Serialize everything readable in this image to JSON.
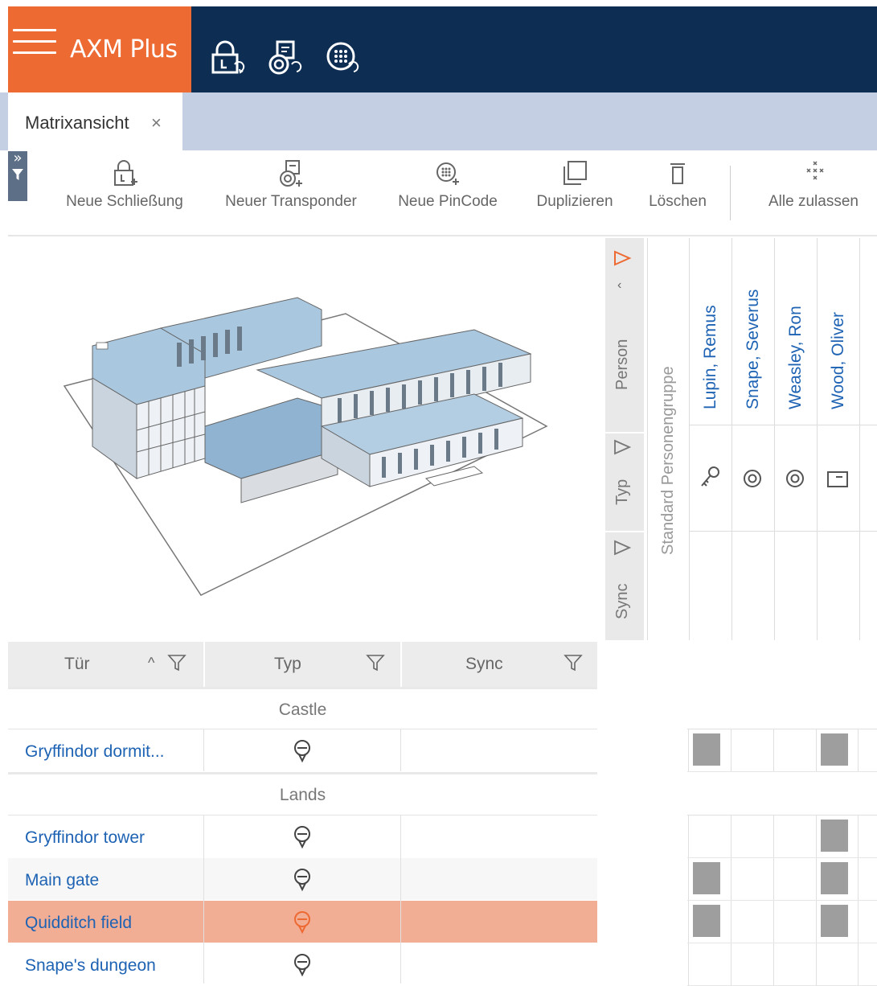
{
  "app": {
    "title": "AXM Plus"
  },
  "header_icons": [
    "lock-sync-icon",
    "transponder-sync-icon",
    "pincode-sync-icon"
  ],
  "tabs": [
    {
      "label": "Matrixansicht",
      "close": "×"
    }
  ],
  "sidebar_toggle": {
    "label": "»"
  },
  "toolbar": {
    "items": [
      {
        "label": "Neue Schließung",
        "icon": "new-lock-icon"
      },
      {
        "label": "Neuer Transponder",
        "icon": "new-transponder-icon"
      },
      {
        "label": "Neue PinCode",
        "icon": "new-pincode-icon"
      },
      {
        "label": "Duplizieren",
        "icon": "duplicate-icon"
      },
      {
        "label": "Löschen",
        "icon": "delete-icon"
      },
      {
        "label": "Alle zulassen",
        "icon": "allow-all-icon"
      }
    ]
  },
  "person_filters": {
    "person": "Person",
    "typ": "Typ",
    "sync": "Sync"
  },
  "person_group": "Standard Personengruppe",
  "persons": [
    {
      "name": "Lupin, Remus",
      "type_icon": "key-icon"
    },
    {
      "name": "Snape, Severus",
      "type_icon": "transponder-icon"
    },
    {
      "name": "Weasley, Ron",
      "type_icon": "transponder-icon"
    },
    {
      "name": "Wood, Oliver",
      "type_icon": "card-icon"
    }
  ],
  "door_table": {
    "headers": {
      "door": "Tür",
      "type": "Typ",
      "sync": "Sync"
    },
    "groups": [
      {
        "name": "Castle",
        "doors": [
          {
            "name": "Gryffindor dormit...",
            "highlight": false,
            "access": [
              true,
              false,
              false,
              true
            ]
          }
        ]
      },
      {
        "name": "Lands",
        "doors": [
          {
            "name": "Gryffindor tower",
            "highlight": false,
            "access": [
              false,
              false,
              false,
              true
            ]
          },
          {
            "name": "Main gate",
            "highlight": false,
            "access": [
              true,
              false,
              false,
              true
            ]
          },
          {
            "name": "Quidditch field",
            "highlight": true,
            "access": [
              true,
              false,
              false,
              true
            ]
          },
          {
            "name": "Snape's dungeon",
            "highlight": false,
            "access": [
              false,
              false,
              false,
              false
            ]
          }
        ]
      }
    ]
  },
  "colors": {
    "brand": "#ee6a33",
    "header": "#0d2d53",
    "tabbar": "#c4cfe3",
    "link": "#1e63b3",
    "highlight_row": "#f2ad95",
    "granted": "#9e9e9e"
  }
}
